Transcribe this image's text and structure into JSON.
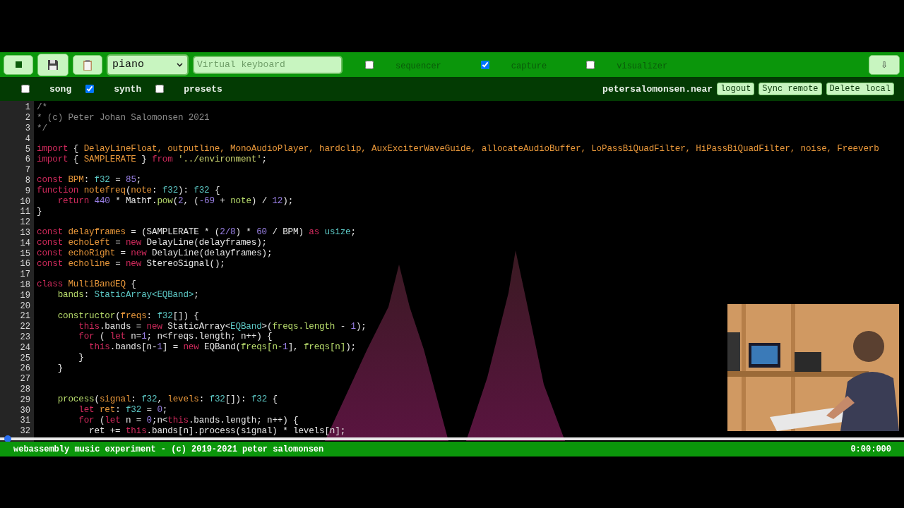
{
  "toolbar": {
    "buttons": [
      {
        "kind": "stop"
      },
      {
        "kind": "save"
      },
      {
        "kind": "clipboard"
      }
    ],
    "instrument_select": {
      "value": "piano"
    },
    "keyboard_field": {
      "placeholder": "Virtual keyboard"
    },
    "toggles": [
      {
        "label": "sequencer",
        "checked": false
      },
      {
        "label": "capture",
        "checked": true
      },
      {
        "label": "visualizer",
        "checked": false
      }
    ],
    "download_button": "⇩"
  },
  "subbar": {
    "toggles": [
      {
        "label": "song",
        "checked": false
      },
      {
        "label": "synth",
        "checked": true
      },
      {
        "label": "presets",
        "checked": false
      }
    ],
    "account": "petersalomonsen.near",
    "buttons": [
      "logout",
      "Sync remote",
      "Delete local"
    ]
  },
  "editor": {
    "lines": [
      {
        "number": "1",
        "tokens": [
          {
            "kind": "cm",
            "text": "/*"
          }
        ]
      },
      {
        "number": "2",
        "tokens": [
          {
            "kind": "cm",
            "text": "* (c) Peter Johan Salomonsen 2021"
          }
        ]
      },
      {
        "number": "3",
        "tokens": [
          {
            "kind": "cm",
            "text": "*/"
          }
        ]
      },
      {
        "number": "4"
      },
      {
        "number": "5",
        "tokens": [
          {
            "kind": "kw",
            "text": "import"
          },
          {
            "kind": "pl",
            "text": " { "
          },
          {
            "kind": "id",
            "text": "DelayLineFloat, outputline, MonoAudioPlayer, hardclip, AuxExciterWaveGuide, allocateAudioBuffer, LoPassBiQuadFilter, HiPassBiQuadFilter, noise, Freeverb"
          }
        ]
      },
      {
        "number": "6",
        "tokens": [
          {
            "kind": "kw",
            "text": "import"
          },
          {
            "kind": "pl",
            "text": " { "
          },
          {
            "kind": "id",
            "text": "SAMPLERATE"
          },
          {
            "kind": "pl",
            "text": " } "
          },
          {
            "kind": "kw",
            "text": "from"
          },
          {
            "kind": "str",
            "text": " '../environment'"
          },
          {
            "kind": "pl",
            "text": ";"
          }
        ]
      },
      {
        "number": "7"
      },
      {
        "number": "8",
        "tokens": [
          {
            "kind": "kw",
            "text": "const"
          },
          {
            "kind": "id",
            "text": " BPM"
          },
          {
            "kind": "pl",
            "text": ": "
          },
          {
            "kind": "ty",
            "text": "f32"
          },
          {
            "kind": "pl",
            "text": " = "
          },
          {
            "kind": "num",
            "text": "85"
          },
          {
            "kind": "pl",
            "text": ";"
          }
        ]
      },
      {
        "number": "9",
        "tokens": [
          {
            "kind": "kw",
            "text": "function"
          },
          {
            "kind": "id",
            "text": " notefreq"
          },
          {
            "kind": "pl",
            "text": "("
          },
          {
            "kind": "id",
            "text": "note"
          },
          {
            "kind": "pl",
            "text": ": "
          },
          {
            "kind": "ty",
            "text": "f32"
          },
          {
            "kind": "pl",
            "text": "): "
          },
          {
            "kind": "ty",
            "text": "f32"
          },
          {
            "kind": "pl",
            "text": " {"
          }
        ]
      },
      {
        "number": "10",
        "tokens": [
          {
            "kind": "kw",
            "text": "    return"
          },
          {
            "kind": "num",
            "text": " 440"
          },
          {
            "kind": "pl",
            "text": " * Mathf."
          },
          {
            "kind": "fn",
            "text": "pow"
          },
          {
            "kind": "pl",
            "text": "("
          },
          {
            "kind": "num",
            "text": "2"
          },
          {
            "kind": "pl",
            "text": ", ("
          },
          {
            "kind": "num",
            "text": "-69"
          },
          {
            "kind": "pl",
            "text": " + "
          },
          {
            "kind": "fn",
            "text": "note"
          },
          {
            "kind": "pl",
            "text": ") / "
          },
          {
            "kind": "num",
            "text": "12"
          },
          {
            "kind": "pl",
            "text": ");"
          }
        ]
      },
      {
        "number": "11",
        "tokens": [
          {
            "kind": "pl",
            "text": "}"
          }
        ]
      },
      {
        "number": "12"
      },
      {
        "number": "13",
        "tokens": [
          {
            "kind": "kw",
            "text": "const"
          },
          {
            "kind": "id",
            "text": " delayframes"
          },
          {
            "kind": "pl",
            "text": " = (SAMPLERATE * ("
          },
          {
            "kind": "num",
            "text": "2/8"
          },
          {
            "kind": "pl",
            "text": ") * "
          },
          {
            "kind": "num",
            "text": "60"
          },
          {
            "kind": "pl",
            "text": " / BPM) "
          },
          {
            "kind": "kw",
            "text": "as"
          },
          {
            "kind": "ty",
            "text": " usize"
          },
          {
            "kind": "pl",
            "text": ";"
          }
        ]
      },
      {
        "number": "14",
        "tokens": [
          {
            "kind": "kw",
            "text": "const"
          },
          {
            "kind": "id",
            "text": " echoLeft"
          },
          {
            "kind": "pl",
            "text": " = "
          },
          {
            "kind": "kw",
            "text": "new"
          },
          {
            "kind": "pl",
            "text": " DelayLine(delayframes);"
          }
        ]
      },
      {
        "number": "15",
        "tokens": [
          {
            "kind": "kw",
            "text": "const"
          },
          {
            "kind": "id",
            "text": " echoRight"
          },
          {
            "kind": "pl",
            "text": " = "
          },
          {
            "kind": "kw",
            "text": "new"
          },
          {
            "kind": "pl",
            "text": " DelayLine(delayframes);"
          }
        ]
      },
      {
        "number": "16",
        "tokens": [
          {
            "kind": "kw",
            "text": "const"
          },
          {
            "kind": "id",
            "text": " echoline"
          },
          {
            "kind": "pl",
            "text": " = "
          },
          {
            "kind": "kw",
            "text": "new"
          },
          {
            "kind": "pl",
            "text": " StereoSignal();"
          }
        ]
      },
      {
        "number": "17"
      },
      {
        "number": "18",
        "tokens": [
          {
            "kind": "kw",
            "text": "class"
          },
          {
            "kind": "id",
            "text": " MultiBandEQ"
          },
          {
            "kind": "pl",
            "text": " {"
          }
        ]
      },
      {
        "number": "19",
        "tokens": [
          {
            "kind": "fn",
            "text": "    bands"
          },
          {
            "kind": "pl",
            "text": ": "
          },
          {
            "kind": "ty",
            "text": "StaticArray<EQBand>"
          },
          {
            "kind": "pl",
            "text": ";"
          }
        ]
      },
      {
        "number": "20"
      },
      {
        "number": "21",
        "tokens": [
          {
            "kind": "fn",
            "text": "    constructor"
          },
          {
            "kind": "pl",
            "text": "("
          },
          {
            "kind": "id",
            "text": "freqs"
          },
          {
            "kind": "pl",
            "text": ": "
          },
          {
            "kind": "ty",
            "text": "f32"
          },
          {
            "kind": "pl",
            "text": "[]) {"
          }
        ]
      },
      {
        "number": "22",
        "tokens": [
          {
            "kind": "kw",
            "text": "        this"
          },
          {
            "kind": "pl",
            "text": ".bands = "
          },
          {
            "kind": "kw",
            "text": "new"
          },
          {
            "kind": "pl",
            "text": " StaticArray<"
          },
          {
            "kind": "ty",
            "text": "EQBand"
          },
          {
            "kind": "pl",
            "text": ">("
          },
          {
            "kind": "fn",
            "text": "freqs.length"
          },
          {
            "kind": "pl",
            "text": " - "
          },
          {
            "kind": "num",
            "text": "1"
          },
          {
            "kind": "pl",
            "text": ");"
          }
        ]
      },
      {
        "number": "23",
        "tokens": [
          {
            "kind": "kw",
            "text": "        for"
          },
          {
            "kind": "pl",
            "text": " ( "
          },
          {
            "kind": "kw",
            "text": "let"
          },
          {
            "kind": "pl",
            "text": " n="
          },
          {
            "kind": "num",
            "text": "1"
          },
          {
            "kind": "pl",
            "text": "; n<freqs.length; n++) {"
          }
        ]
      },
      {
        "number": "24",
        "tokens": [
          {
            "kind": "kw",
            "text": "          this"
          },
          {
            "kind": "pl",
            "text": ".bands[n-"
          },
          {
            "kind": "num",
            "text": "1"
          },
          {
            "kind": "pl",
            "text": "] = "
          },
          {
            "kind": "kw",
            "text": "new"
          },
          {
            "kind": "pl",
            "text": " EQBand("
          },
          {
            "kind": "fn",
            "text": "freqs[n-"
          },
          {
            "kind": "num",
            "text": "1"
          },
          {
            "kind": "pl",
            "text": "], "
          },
          {
            "kind": "fn",
            "text": "freqs[n]"
          },
          {
            "kind": "pl",
            "text": ");"
          }
        ]
      },
      {
        "number": "25",
        "tokens": [
          {
            "kind": "pl",
            "text": "        }"
          }
        ]
      },
      {
        "number": "26",
        "tokens": [
          {
            "kind": "pl",
            "text": "    }"
          }
        ]
      },
      {
        "number": "27"
      },
      {
        "number": "28"
      },
      {
        "number": "29",
        "tokens": [
          {
            "kind": "fn",
            "text": "    process"
          },
          {
            "kind": "pl",
            "text": "("
          },
          {
            "kind": "id",
            "text": "signal"
          },
          {
            "kind": "pl",
            "text": ": "
          },
          {
            "kind": "ty",
            "text": "f32"
          },
          {
            "kind": "pl",
            "text": ", "
          },
          {
            "kind": "id",
            "text": "levels"
          },
          {
            "kind": "pl",
            "text": ": "
          },
          {
            "kind": "ty",
            "text": "f32"
          },
          {
            "kind": "pl",
            "text": "[]): "
          },
          {
            "kind": "ty",
            "text": "f32"
          },
          {
            "kind": "pl",
            "text": " {"
          }
        ]
      },
      {
        "number": "30",
        "tokens": [
          {
            "kind": "kw",
            "text": "        let"
          },
          {
            "kind": "id",
            "text": " ret"
          },
          {
            "kind": "pl",
            "text": ": "
          },
          {
            "kind": "ty",
            "text": "f32"
          },
          {
            "kind": "pl",
            "text": " = "
          },
          {
            "kind": "num",
            "text": "0"
          },
          {
            "kind": "pl",
            "text": ";"
          }
        ]
      },
      {
        "number": "31",
        "tokens": [
          {
            "kind": "kw",
            "text": "        for"
          },
          {
            "kind": "pl",
            "text": " ("
          },
          {
            "kind": "kw",
            "text": "let"
          },
          {
            "kind": "pl",
            "text": " n = "
          },
          {
            "kind": "num",
            "text": "0"
          },
          {
            "kind": "pl",
            "text": ";n<"
          },
          {
            "kind": "kw",
            "text": "this"
          },
          {
            "kind": "pl",
            "text": ".bands.length; n++) {"
          }
        ]
      },
      {
        "number": "32",
        "tokens": [
          {
            "kind": "pl",
            "text": "          ret += "
          },
          {
            "kind": "kw",
            "text": "this"
          },
          {
            "kind": "pl",
            "text": ".bands[n].process(signal) * levels[n];"
          }
        ]
      }
    ]
  },
  "video_progress": {
    "level": 0.008
  },
  "status_bar": {
    "text": "webassembly music experiment - (c) 2019-2021 peter salomonsen",
    "time": "0:00:000"
  }
}
